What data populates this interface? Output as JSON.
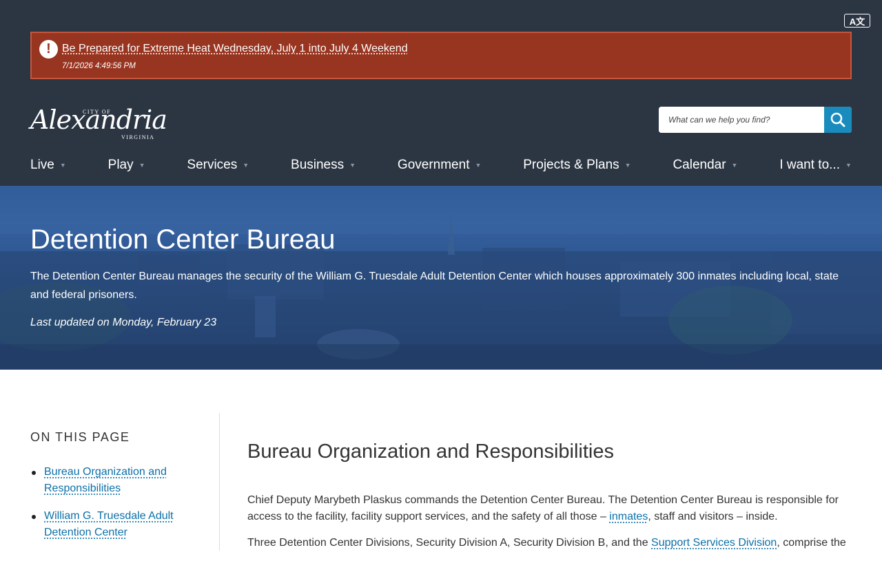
{
  "translate": {
    "label": "A文"
  },
  "alert": {
    "title": "Be Prepared for Extreme Heat Wednesday, July 1 into July 4 Weekend",
    "timestamp": "7/1/2026 4:49:56 PM",
    "icon": "exclamation-icon"
  },
  "logo": {
    "city_of": "CITY OF",
    "name": "Alexandria",
    "state": "VIRGINIA"
  },
  "search": {
    "placeholder": "What can we help you find?",
    "icon": "search-icon"
  },
  "nav": [
    {
      "label": "Live"
    },
    {
      "label": "Play"
    },
    {
      "label": "Services"
    },
    {
      "label": "Business"
    },
    {
      "label": "Government"
    },
    {
      "label": "Projects & Plans"
    },
    {
      "label": "Calendar"
    },
    {
      "label": "I want to..."
    }
  ],
  "hero": {
    "title": "Detention Center Bureau",
    "description": "The Detention Center Bureau manages the security of the William G. Truesdale Adult Detention Center which houses approximately 300 inmates including local, state and federal prisoners.",
    "updated": "Last updated on Monday, February 23"
  },
  "sidebar": {
    "heading": "ON THIS PAGE",
    "links": [
      {
        "label": "Bureau Organization and Responsibilities"
      },
      {
        "label": "William G. Truesdale Adult Detention Center"
      }
    ]
  },
  "main": {
    "heading": "Bureau Organization and Responsibilities",
    "p1_before": "Chief Deputy Marybeth Plaskus commands the Detention Center Bureau. The Detention Center Bureau is responsible for access to the facility, facility support services, and the safety of all those – ",
    "p1_link": "inmates",
    "p1_after": ", staff and visitors – inside.",
    "p2_before": "Three Detention Center Divisions, Security Division A, Security Division B, and the ",
    "p2_link": "Support Services Division",
    "p2_after": ", comprise the"
  },
  "colors": {
    "header_bg": "#2c3643",
    "alert_bg": "#983521",
    "link": "#0b6fa8",
    "search_button": "#1a8bbd"
  }
}
